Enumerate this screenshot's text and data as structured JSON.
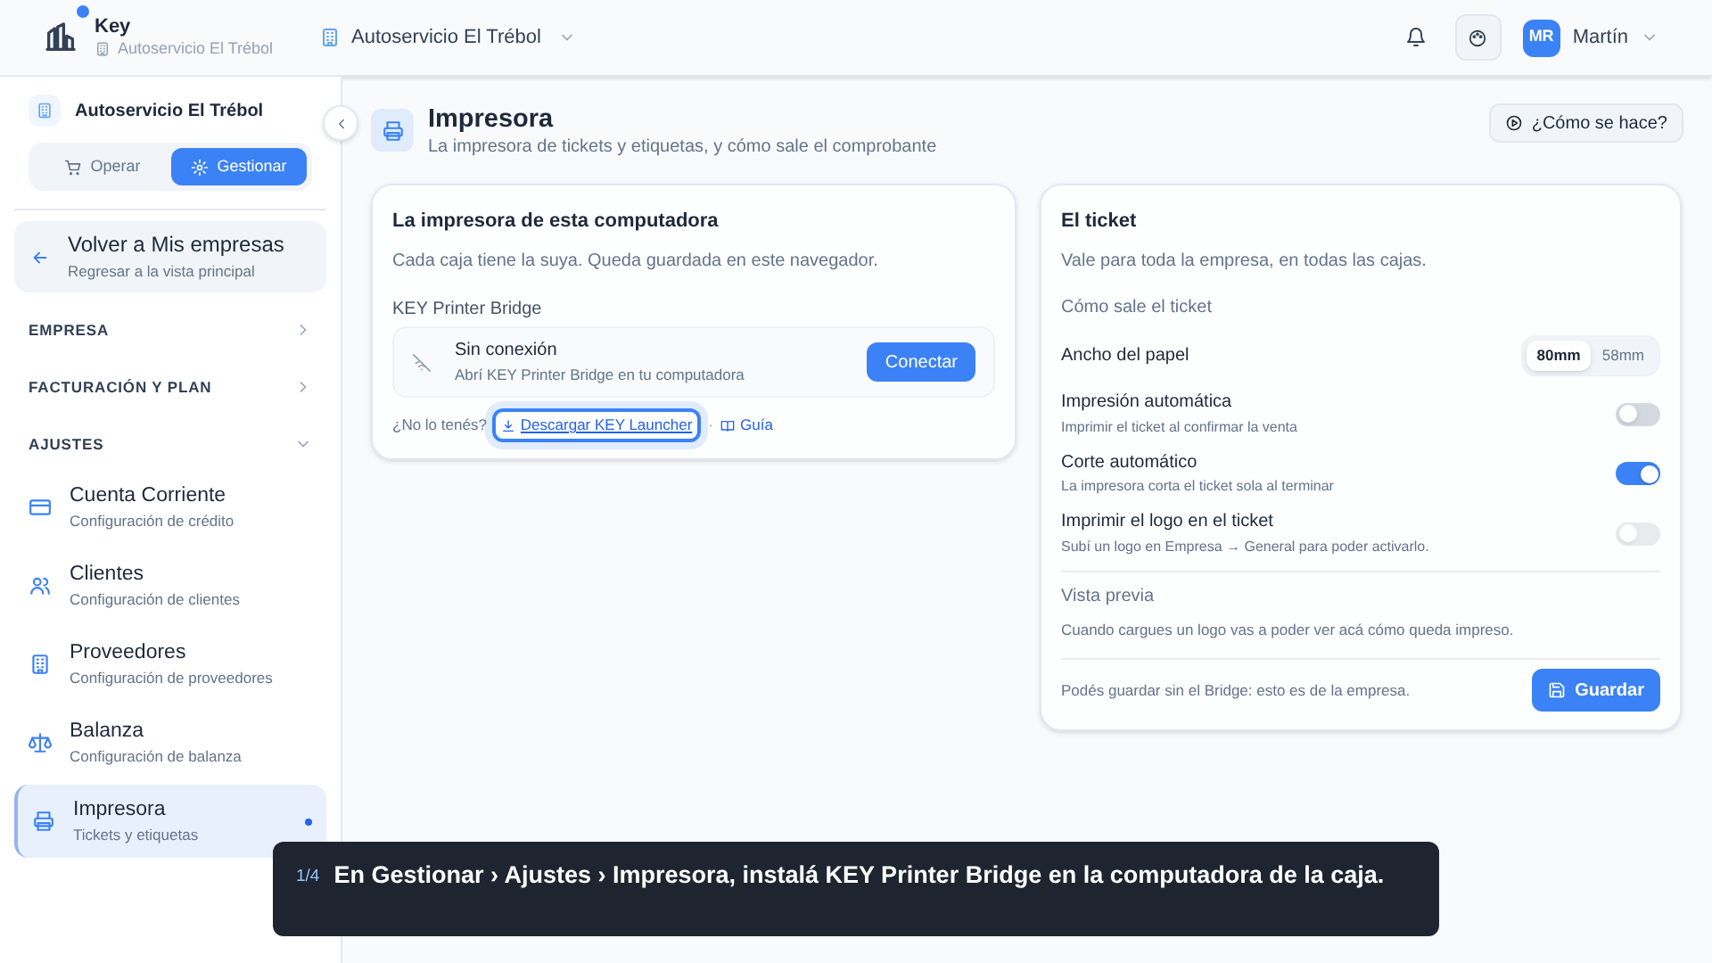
{
  "header": {
    "app_name": "Key",
    "app_subtitle": "Autoservicio El Trébol",
    "notification_dot": true,
    "company_selector": "Autoservicio El Trébol",
    "user_initials": "MR",
    "user_name": "Martín"
  },
  "sidebar": {
    "company": "Autoservicio El Trébol",
    "mode_tabs": [
      {
        "label": "Operar",
        "selected": false
      },
      {
        "label": "Gestionar",
        "selected": true
      }
    ],
    "back_link": {
      "title": "Volver a Mis empresas",
      "subtitle": "Regresar a la vista principal"
    },
    "sections": [
      {
        "label": "EMPRESA",
        "expanded": false
      },
      {
        "label": "FACTURACIÓN Y PLAN",
        "expanded": false
      },
      {
        "label": "AJUSTES",
        "expanded": true,
        "children": [
          {
            "kind": "card",
            "title": "Cuenta Corriente",
            "subtitle": "Configuración de crédito",
            "selected": false
          },
          {
            "kind": "people",
            "title": "Clientes",
            "subtitle": "Configuración de clientes",
            "selected": false
          },
          {
            "kind": "building",
            "title": "Proveedores",
            "subtitle": "Configuración de proveedores",
            "selected": false
          },
          {
            "kind": "scale",
            "title": "Balanza",
            "subtitle": "Configuración de balanza",
            "selected": false
          },
          {
            "kind": "printer",
            "title": "Impresora",
            "subtitle": "Tickets y etiquetas",
            "selected": true
          }
        ]
      }
    ]
  },
  "page": {
    "title": "Impresora",
    "subtitle": "La impresora de tickets y etiquetas, y cómo sale el comprobante",
    "help_button": "¿Cómo se hace?"
  },
  "printer_card": {
    "title": "La impresora de esta computadora",
    "description": "Cada caja tiene la suya. Queda guardada en este navegador.",
    "bridge_label": "KEY Printer Bridge",
    "status": {
      "title": "Sin conexión",
      "subtitle": "Abrí KEY Printer Bridge en tu computadora"
    },
    "connect_button": "Conectar",
    "prompt": "¿No lo tenés?",
    "download_link": "Descargar KEY Launcher",
    "separator": "·",
    "guide_link": "Guía"
  },
  "ticket_card": {
    "title": "El ticket",
    "description": "Vale para toda la empresa, en todas las cajas.",
    "section_label": "Cómo sale el ticket",
    "paper_width": {
      "label": "Ancho del papel",
      "options": [
        {
          "label": "80mm",
          "selected": true
        },
        {
          "label": "58mm",
          "selected": false
        }
      ]
    },
    "toggles": [
      {
        "title": "Impresión automática",
        "subtitle": "Imprimir el ticket al confirmar la venta",
        "on": false,
        "disabled": false
      },
      {
        "title": "Corte automático",
        "subtitle": "La impresora corta el ticket sola al terminar",
        "on": true,
        "disabled": false
      },
      {
        "title": "Imprimir el logo en el ticket",
        "subtitle": "Subí un logo en Empresa → General para poder activarlo.",
        "on": false,
        "disabled": true
      }
    ],
    "preview": {
      "title": "Vista previa",
      "text": "Cuando cargues un logo vas a poder ver acá cómo queda impreso."
    },
    "footer_note": "Podés guardar sin el Bridge: esto es de la empresa.",
    "save_button": "Guardar"
  },
  "tour": {
    "step": "1/4",
    "text": "En Gestionar › Ajustes › Impresora, instalá KEY Printer Bridge en la computadora de la caja."
  }
}
